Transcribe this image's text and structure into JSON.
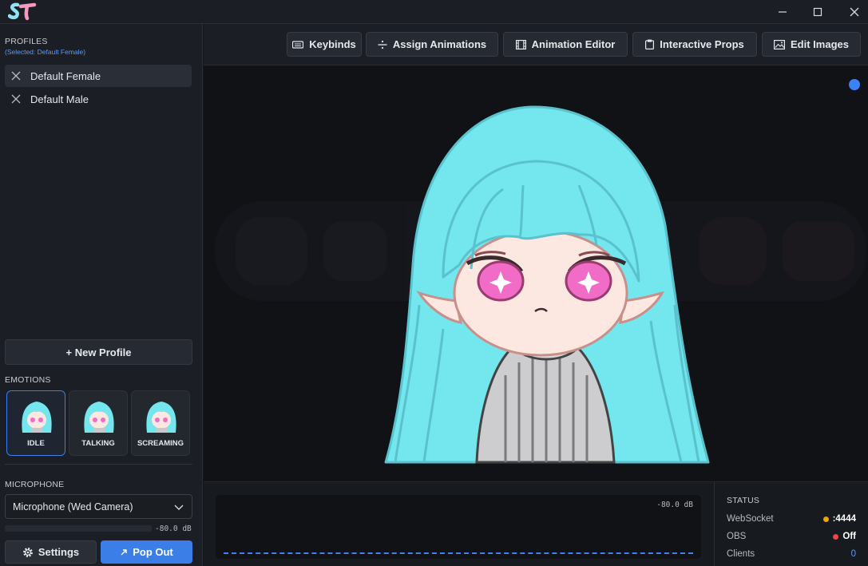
{
  "window": {
    "minimize_icon": "minimize-icon",
    "maximize_icon": "maximize-icon",
    "close_icon": "close-icon"
  },
  "sidebar": {
    "profiles_title": "PROFILES",
    "profiles_selected": "(Selected: Default Female)",
    "profiles": [
      {
        "name": "Default Female",
        "selected": true
      },
      {
        "name": "Default Male",
        "selected": false
      }
    ],
    "new_profile_label": "+ New Profile",
    "emotions_title": "EMOTIONS",
    "emotions": [
      {
        "label": "IDLE",
        "selected": true
      },
      {
        "label": "TALKING",
        "selected": false
      },
      {
        "label": "SCREAMING",
        "selected": false
      }
    ],
    "microphone_title": "MICROPHONE",
    "microphone_value": "Microphone (Wed Camera)",
    "mic_db": "-80.0 dB",
    "settings_label": "Settings",
    "popout_label": "Pop Out"
  },
  "toolbar": {
    "buttons": [
      {
        "label": "Keybinds",
        "icon": "keyboard-icon"
      },
      {
        "label": "Assign Animations",
        "icon": "divide-icon"
      },
      {
        "label": "Animation Editor",
        "icon": "film-icon"
      },
      {
        "label": "Interactive Props",
        "icon": "clipboard-icon"
      },
      {
        "label": "Edit Images",
        "icon": "image-icon"
      }
    ]
  },
  "audio": {
    "db_label": "-80.0 dB",
    "level_fraction": 0
  },
  "status": {
    "title": "STATUS",
    "websocket_label": "WebSocket",
    "websocket_value": ":4444",
    "websocket_color": "#f59e0b",
    "obs_label": "OBS",
    "obs_value": "Off",
    "obs_color": "#ef4444",
    "clients_label": "Clients",
    "clients_value": "0"
  },
  "colors": {
    "accent": "#3b7ee8",
    "hair": "#74e6ee",
    "eyes": "#f06cc6"
  }
}
